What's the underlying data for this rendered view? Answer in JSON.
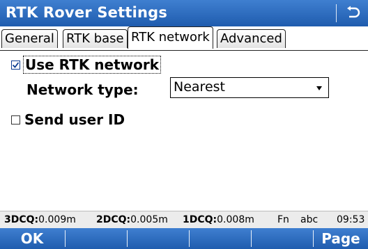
{
  "window": {
    "title": "RTK Rover Settings"
  },
  "tabs": [
    {
      "label": "General"
    },
    {
      "label": "RTK base"
    },
    {
      "label": "RTK network"
    },
    {
      "label": "Advanced"
    }
  ],
  "form": {
    "use_rtk_network": {
      "label": "Use RTK network",
      "checked": true
    },
    "network_type": {
      "label": "Network type:",
      "value": "Nearest"
    },
    "send_user_id": {
      "label": "Send user ID",
      "checked": false
    }
  },
  "status": {
    "dcq3_label": "3DCQ:",
    "dcq3_value": "0.009m",
    "dcq2_label": "2DCQ:",
    "dcq2_value": "0.005m",
    "dcq1_label": "1DCQ:",
    "dcq1_value": "0.008m",
    "fn": "Fn",
    "input_mode": "abc",
    "time": "09:53"
  },
  "softkeys": {
    "ok": "OK",
    "page": "Page"
  },
  "colors": {
    "bar": "#2a68bd",
    "check": "#0a3c8f"
  }
}
